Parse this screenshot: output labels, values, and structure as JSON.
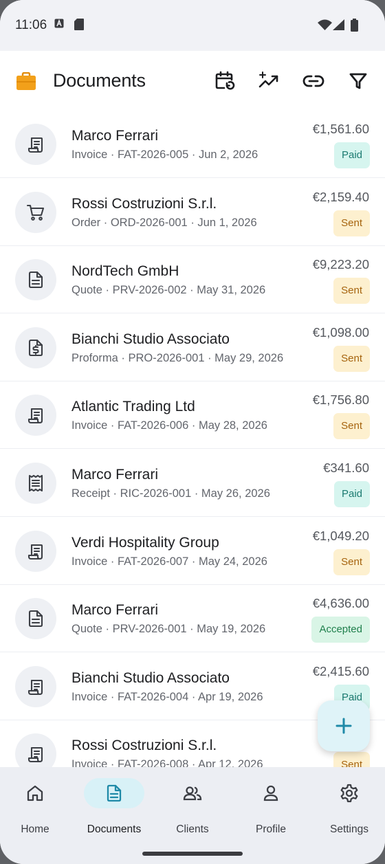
{
  "status_bar": {
    "time": "11:06"
  },
  "header": {
    "title": "Documents"
  },
  "documents": [
    {
      "name": "Marco Ferrari",
      "meta": "Invoice · FAT-2026-005 · Jun 2, 2026",
      "amount": "€1,561.60",
      "status": "Paid",
      "icon": "invoice-icon"
    },
    {
      "name": "Rossi Costruzioni S.r.l.",
      "meta": "Order · ORD-2026-001 · Jun 1, 2026",
      "amount": "€2,159.40",
      "status": "Sent",
      "icon": "cart-icon"
    },
    {
      "name": "NordTech GmbH",
      "meta": "Quote · PRV-2026-002 · May 31, 2026",
      "amount": "€9,223.20",
      "status": "Sent",
      "icon": "document-icon"
    },
    {
      "name": "Bianchi Studio Associato",
      "meta": "Proforma · PRO-2026-001 · May 29, 2026",
      "amount": "€1,098.00",
      "status": "Sent",
      "icon": "proforma-icon"
    },
    {
      "name": "Atlantic Trading Ltd",
      "meta": "Invoice · FAT-2026-006 · May 28, 2026",
      "amount": "€1,756.80",
      "status": "Sent",
      "icon": "invoice-icon"
    },
    {
      "name": "Marco Ferrari",
      "meta": "Receipt · RIC-2026-001 · May 26, 2026",
      "amount": "€341.60",
      "status": "Paid",
      "icon": "receipt-icon"
    },
    {
      "name": "Verdi Hospitality Group",
      "meta": "Invoice · FAT-2026-007 · May 24, 2026",
      "amount": "€1,049.20",
      "status": "Sent",
      "icon": "invoice-icon"
    },
    {
      "name": "Marco Ferrari",
      "meta": "Quote · PRV-2026-001 · May 19, 2026",
      "amount": "€4,636.00",
      "status": "Accepted",
      "icon": "document-icon"
    },
    {
      "name": "Bianchi Studio Associato",
      "meta": "Invoice · FAT-2026-004 · Apr 19, 2026",
      "amount": "€2,415.60",
      "status": "Paid",
      "icon": "invoice-icon"
    },
    {
      "name": "Rossi Costruzioni S.r.l.",
      "meta": "Invoice · FAT-2026-008 · Apr 12, 2026",
      "amount": "",
      "status": "Sent",
      "icon": "invoice-icon"
    }
  ],
  "nav": [
    {
      "label": "Home",
      "icon": "home-icon"
    },
    {
      "label": "Documents",
      "icon": "document-icon",
      "active": true
    },
    {
      "label": "Clients",
      "icon": "people-icon"
    },
    {
      "label": "Profile",
      "icon": "person-icon"
    },
    {
      "label": "Settings",
      "icon": "gear-icon"
    }
  ],
  "colors": {
    "accent": "#1f8aa8",
    "paid": "#1b7a70",
    "sent": "#a6640f",
    "accepted": "#1f7f4c",
    "logo": "#f2a01a"
  }
}
